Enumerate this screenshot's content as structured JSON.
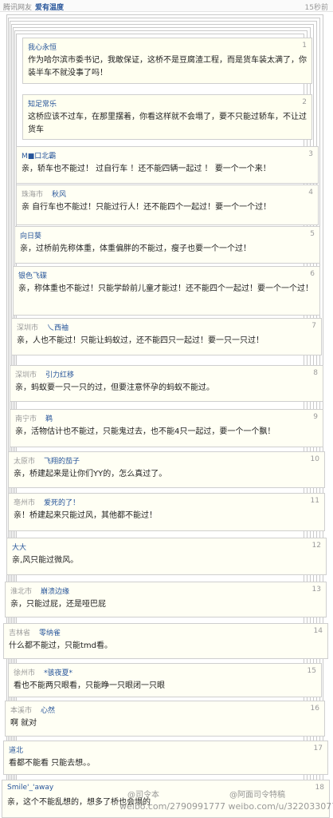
{
  "topbar": {
    "location": "腾讯网友",
    "user": "爱有温度",
    "time": "15秒前"
  },
  "comments": [
    {
      "num": "1",
      "location": "",
      "name": "我心永恒",
      "text": "作为哈尔滨市委书记，我敢保证，这桥不是豆腐渣工程，而是货车装太满了，你装半车不就没事了吗！"
    },
    {
      "num": "2",
      "location": "",
      "name": "知足常乐",
      "text": "这桥应该不过车，在那里摆着，你看这样就不会塌了，要不只能过轿车，不让过货车"
    },
    {
      "num": "3",
      "location": "",
      "name": "M■口北霸",
      "text": "亲，轿车也不能过！ 过自行车 ！还不能四辆一起过 ！ 要一个一个来！"
    },
    {
      "num": "4",
      "location": "珠海市",
      "name": "秋风",
      "text": "亲 自行车也不能过！只能过行人！还不能四个一起过！要一个一个过！"
    },
    {
      "num": "5",
      "location": "",
      "name": "向日葵",
      "text": "亲，过桥前先称体重，体重偏胖的不能过，瘦子也要一个一个过！"
    },
    {
      "num": "6",
      "location": "",
      "name": "银色飞碟",
      "text": "亲，称体重也不能过！只能学龄前儿童才能过！还不能四个一起过！要一个一个过！"
    },
    {
      "num": "7",
      "location": "深圳市",
      "name": "乀西袖",
      "text": "亲，人也不能过！只能让蚂蚁过，还不能四只一起过！要一只一只过！"
    },
    {
      "num": "8",
      "location": "深圳市",
      "name": "引力红移",
      "text": "亲，蚂蚁要一只一只的过，但要注意怀孕的蚂蚁不能过。"
    },
    {
      "num": "9",
      "location": "南宁市",
      "name": "鹈",
      "text": "亲，活物估计也不能过，只能鬼过去，也不能4只一起过，要一个一个飘！"
    },
    {
      "num": "10",
      "location": "太原市",
      "name": "飞翔的茄子",
      "text": "亲，桥建起来是让你们YY的，怎么真过了。"
    },
    {
      "num": "11",
      "location": "亳州市",
      "name": "爱死的了！",
      "text": "亲！桥建起来只能过风，其他都不能过！"
    },
    {
      "num": "12",
      "location": "",
      "name": "大大",
      "text": "亲,风只能过微风。"
    },
    {
      "num": "13",
      "location": "淮北市",
      "name": "崩溃边缘",
      "text": "亲，只能过屁，还是哑巴屁"
    },
    {
      "num": "14",
      "location": "吉林省",
      "name": "零纳雀",
      "text": "什么都不能过，只能tmd看。"
    },
    {
      "num": "15",
      "location": "徐州市",
      "name": "*骇夜夏*",
      "text": "看也不能两只眼看，只能睁一只眼闭一只眼"
    },
    {
      "num": "16",
      "location": "本溪市",
      "name": "心然",
      "text": "啊 就对"
    },
    {
      "num": "17",
      "location": "",
      "name": "道北",
      "text": "看都不能看 只能去想。。"
    },
    {
      "num": "18",
      "location": "",
      "name": "Smile'_'away",
      "text": "亲，这个不能乱想的，想多了桥也会塌的"
    }
  ],
  "watermark": {
    "left": "@司令本",
    "right": "@阿面司令特稿",
    "url": "weibo.com/2790991777 weibo.com/u/3220330774"
  }
}
